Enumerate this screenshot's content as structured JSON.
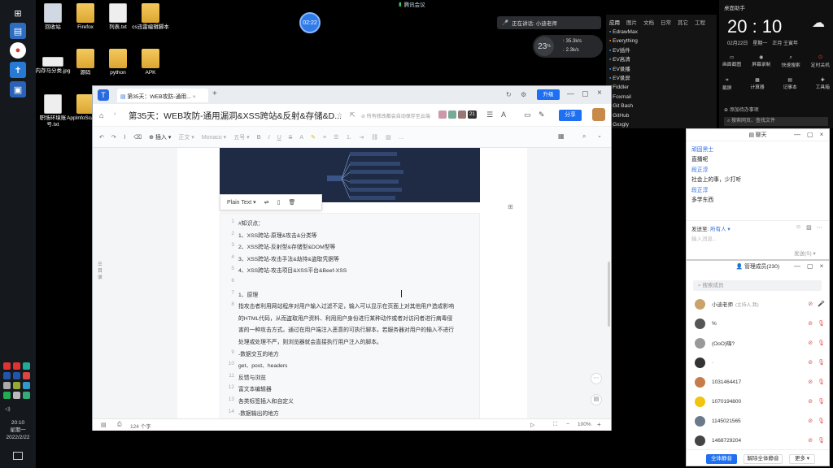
{
  "taskbar": {
    "clock_time": "20:10",
    "clock_day": "星期一",
    "clock_date": "2022/2/22"
  },
  "desktop_icons": [
    {
      "label": "回收站",
      "kind": "recycle"
    },
    {
      "label": "Firefox",
      "kind": "folder"
    },
    {
      "label": "列表.txt",
      "kind": "file"
    },
    {
      "label": "cs迅雷编辑脚本",
      "kind": "folder"
    },
    {
      "label": "内存马分类.jpg",
      "kind": "file"
    },
    {
      "label": "源码",
      "kind": "folder"
    },
    {
      "label": "python",
      "kind": "folder"
    },
    {
      "label": "APK",
      "kind": "folder"
    },
    {
      "label": "职场环境账号.txt",
      "kind": "file"
    },
    {
      "label": "AppInfoScanner",
      "kind": "folder"
    }
  ],
  "top_bar": {
    "meeting_label": "腾讯会议",
    "timer": "02:22"
  },
  "speaking_bar": {
    "label": "正在讲话: 小迪老师"
  },
  "net_widget": {
    "percent": "23",
    "unit": "%",
    "up": "35.3k/s",
    "down": "2.3k/s"
  },
  "app_list": {
    "tabs": [
      "应用",
      "图片",
      "文档",
      "日常",
      "其它",
      "工程"
    ],
    "items": [
      "EdrawMax",
      "Everything",
      "EV插件",
      "EV高清",
      "EV录播",
      "EV录屏",
      "Fiddler",
      "Foxmail",
      "Git Bash",
      "GitHub",
      "Gxxgly"
    ]
  },
  "clock_panel": {
    "title": "桌面助手",
    "time": "20 : 10",
    "date": "02月22日",
    "weekday": "星期一",
    "lunar": "正月 壬寅年",
    "actions_row1": [
      "画面截图",
      "屏幕录制",
      "快速搜索",
      "定时关机"
    ],
    "actions_row2": [
      "截屏",
      "计算器",
      "记事本",
      "工具箱"
    ],
    "add_todo": "添加待办事项",
    "search_placeholder": "搜索网页、查找文件"
  },
  "editor": {
    "tab_title": "第35天：WEB攻防-通用...",
    "doc_title": "第35天：WEB攻防-通用漏洞&XSS跨站&反射&存储&D...",
    "save_hint": "所有修改都会自动保存至云端",
    "upgrade": "升级",
    "share": "分享",
    "avatar_count": "21",
    "font_family": "Monaco",
    "font_size": "五号",
    "insert_label": "插入",
    "body_label": "正文",
    "plain_text_label": "Plain Text",
    "word_count": "124 个字",
    "zoom": "100%",
    "side_label": "目录",
    "lines": [
      {
        "n": "1",
        "t": "#知识点："
      },
      {
        "n": "2",
        "t": "1、XSS跨站-原理&攻击&分类等"
      },
      {
        "n": "3",
        "t": "2、XSS跨站-反射型&存储型&DOM型等"
      },
      {
        "n": "4",
        "t": "3、XSS跨站-攻击手法&劫持&盗取凭据等"
      },
      {
        "n": "5",
        "t": "4、XSS跨站-攻击项目&XSS平台&Beef-XSS"
      },
      {
        "n": "6",
        "t": ""
      },
      {
        "n": "7",
        "t": "1、原理"
      },
      {
        "n": "8",
        "t": "指攻击者利用网站程序对用户输入过滤不足，输入可以显示在页面上对其他用户造成影响"
      },
      {
        "n": "",
        "t": "的HTML代码，从而盗取用户资料、利用用户身份进行某种动作或者对访问者进行病毒侵"
      },
      {
        "n": "",
        "t": "害的一种攻击方式。通过在用户端注入恶意的可执行脚本，若服务器对用户的输入不进行"
      },
      {
        "n": "",
        "t": "处理或处理不严，则浏览器就会直接执行用户注入的脚本。"
      },
      {
        "n": "9",
        "t": "-数据交互的地方"
      },
      {
        "n": "10",
        "t": "    get、post、headers"
      },
      {
        "n": "11",
        "t": "    反馈与浏览"
      },
      {
        "n": "12",
        "t": "    富文本编辑器"
      },
      {
        "n": "13",
        "t": "    各类标签插入和自定义"
      },
      {
        "n": "14",
        "t": "-数据输出的地方"
      }
    ]
  },
  "chat1": {
    "title": "聊天",
    "messages": [
      {
        "name": "顽固黑士",
        "text": "直播呢"
      },
      {
        "name": "段正淳",
        "text": "社会上的事，少打听"
      },
      {
        "name": "段正淳",
        "text": "多学东西"
      }
    ],
    "send_to_label": "发送至:",
    "send_to_value": "所有人",
    "input_placeholder": "输入消息...",
    "send_button": "发送(S)"
  },
  "chat2": {
    "title": "管理成员(230)",
    "search_placeholder": "搜索成员",
    "members": [
      {
        "name": "小迪老师",
        "sub": "(主持人,我)",
        "color": "#c9a36b"
      },
      {
        "name": "%",
        "sub": "",
        "color": "#555"
      },
      {
        "name": "(OoO)嗨?",
        "sub": "",
        "color": "#999"
      },
      {
        "name": "·",
        "sub": "",
        "color": "#333"
      },
      {
        "name": "1031464417",
        "sub": "",
        "color": "#c77b4a"
      },
      {
        "name": "1070194800",
        "sub": "",
        "color": "#f2c40f"
      },
      {
        "name": "1145021565",
        "sub": "",
        "color": "#6a7a8a"
      },
      {
        "name": "1468729204",
        "sub": "",
        "color": "#444"
      }
    ],
    "mute_all": "全体静音",
    "unmute_all": "解除全体静音",
    "more": "更多"
  }
}
